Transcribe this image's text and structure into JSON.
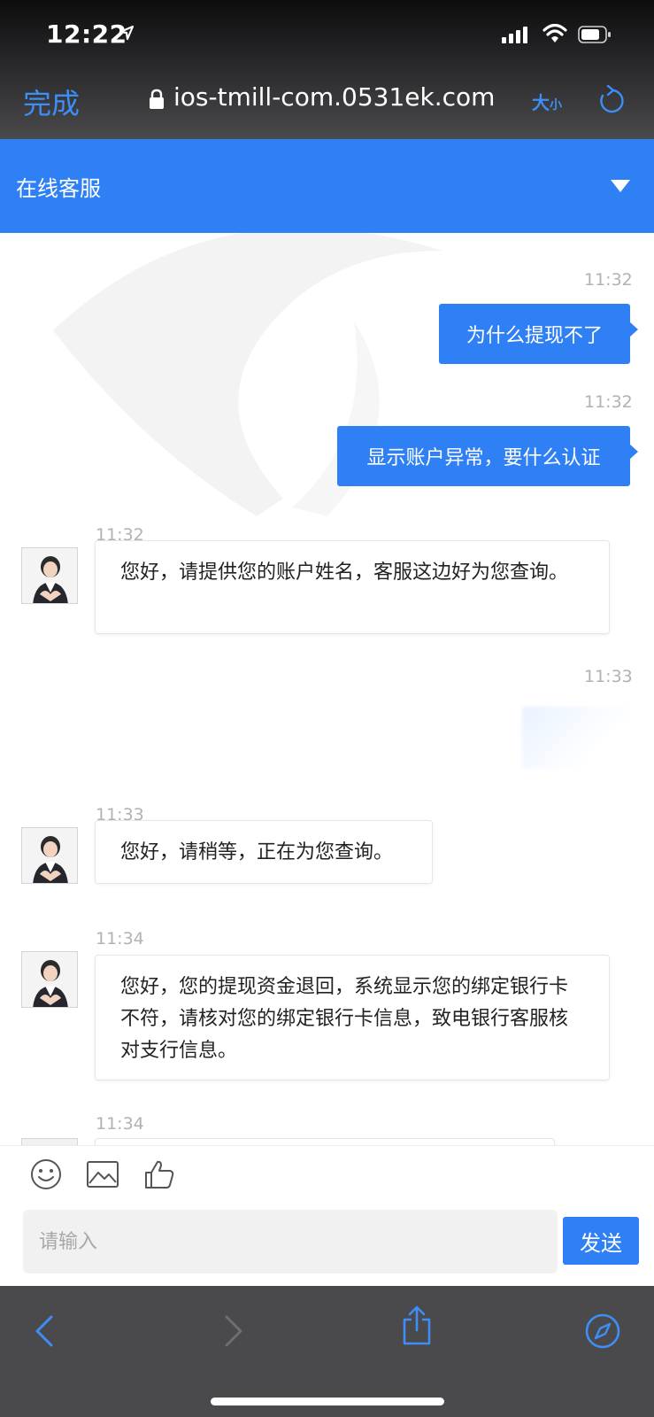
{
  "status_bar": {
    "time": "12:22"
  },
  "browser": {
    "done_label": "完成",
    "url": "ios-tmill-com.0531ek.com",
    "text_size_big": "大",
    "text_size_small": "小"
  },
  "header": {
    "title": "在线客服"
  },
  "messages": [
    {
      "time": "11:32",
      "from": "user",
      "text": "为什么提现不了"
    },
    {
      "time": "11:32",
      "from": "user",
      "text": "显示账户异常，要什么认证"
    },
    {
      "time": "11:32",
      "from": "agent",
      "text": "您好，请提供您的账户姓名，客服这边好为您查询。"
    },
    {
      "time": "11:33",
      "from": "user",
      "text": ""
    },
    {
      "time": "11:33",
      "from": "agent",
      "text": "您好，请稍等，正在为您查询。"
    },
    {
      "time": "11:34",
      "from": "agent",
      "text": "您好，您的提现资金退回，系统显示您的绑定银行卡不符，请核对您的绑定银行卡信息，致电银行客服核对支行信息。"
    },
    {
      "time": "11:34",
      "from": "agent",
      "text": ""
    }
  ],
  "input": {
    "placeholder": "请输入",
    "send_label": "发送"
  },
  "colors": {
    "accent": "#2f80f5",
    "ios_link": "#3e8ef7",
    "chrome": "#4a4a4c"
  },
  "icons": [
    "location-arrow-icon",
    "signal-icon",
    "wifi-icon",
    "battery-icon",
    "lock-icon",
    "reload-icon",
    "caret-down-icon",
    "emoji-icon",
    "image-icon",
    "thumbs-up-icon",
    "back-icon",
    "forward-icon",
    "share-icon",
    "compass-icon"
  ]
}
